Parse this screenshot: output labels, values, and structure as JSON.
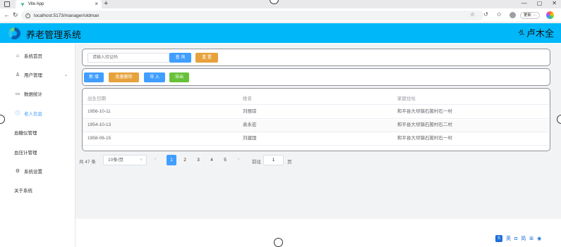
{
  "browser": {
    "tab_title": "Vite App",
    "tab_close": "×",
    "new_tab": "+",
    "window_controls": [
      "—",
      "▢",
      "✕"
    ],
    "url": "localhost:5173/manager/oldman",
    "update_label": "更新 ···"
  },
  "header": {
    "title": "养老管理系统",
    "user_name": "卢木全",
    "background": "#00b7f9"
  },
  "sidebar": {
    "items": [
      {
        "label": "系统首页",
        "icon": "home-icon"
      },
      {
        "label": "用户管理",
        "icon": "user-icon",
        "expandable": true
      },
      {
        "label": "数据统计",
        "icon": "monitor-icon"
      },
      {
        "label": "老人信息",
        "icon": "info-icon",
        "active": true
      },
      {
        "label": "血糖仪管理"
      },
      {
        "label": "血压计管理"
      },
      {
        "label": "系统设置",
        "icon": "gear-icon"
      },
      {
        "label": "关于系统"
      }
    ]
  },
  "search": {
    "placeholder": "请输入验证码",
    "query_button": "查 询",
    "reset_button": "重 置"
  },
  "actions": {
    "add": "新 增",
    "batch_delete": "批量删除",
    "import": "导 入",
    "export": "导出"
  },
  "table": {
    "headers": [
      "出生日期",
      "姓名",
      "家庭住址"
    ],
    "rows": [
      [
        "1956-10-11",
        "刘丽琼",
        "和平县大坝镇石陂村石一村"
      ],
      [
        "1954-10-13",
        "袁永宏",
        "和平县大坝镇石陂村石二村"
      ],
      [
        "1958-06-15",
        "刘建国",
        "和平县大坝镇石陂村石一村"
      ]
    ]
  },
  "pagination": {
    "total": "共 47 条",
    "page_size": "10条/页",
    "prev": "‹",
    "next": "›",
    "pages": [
      "1",
      "2",
      "3",
      "4",
      "5"
    ],
    "current_page": "1",
    "goto_label": "前往",
    "goto_value": "1",
    "goto_unit": "页"
  },
  "ime": {
    "labels": [
      "英",
      "简"
    ]
  },
  "colors": {
    "primary": "#409eff",
    "warning": "#e6a23c",
    "success": "#67c23a",
    "header": "#00b7f9"
  }
}
